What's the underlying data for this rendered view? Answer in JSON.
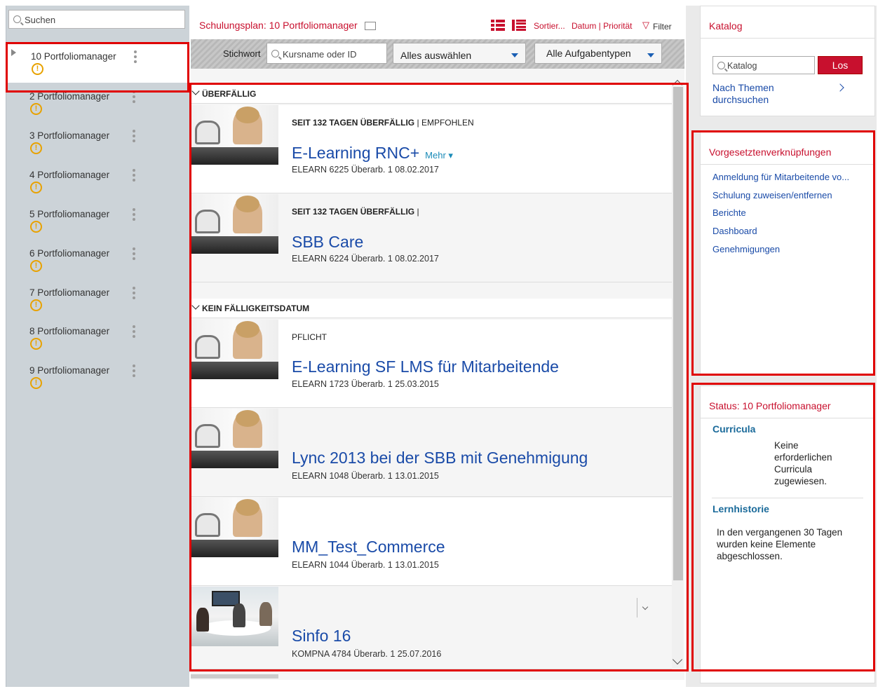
{
  "sidebar": {
    "search_placeholder": "Suchen",
    "selected_manager": "10 Portfoliomanager",
    "managers": [
      "2 Portfoliomanager",
      "3 Portfoliomanager",
      "4 Portfoliomanager",
      "5 Portfoliomanager",
      "6 Portfoliomanager",
      "7 Portfoliomanager",
      "8 Portfoliomanager",
      "9 Portfoliomanager"
    ],
    "warning_glyph": "!"
  },
  "plan": {
    "title": "Schulungsplan: 10 Portfoliomanager",
    "sort_label": "Sortier...",
    "sort_options": "Datum | Priorität",
    "filter_label": "Filter",
    "keyword_label": "Stichwort",
    "keyword_placeholder": "Kursname oder ID",
    "select_all": "Alles auswählen",
    "task_types": "Alle Aufgabentypen"
  },
  "sections": {
    "overdue": "ÜBERFÄLLIG",
    "no_due": "KEIN FÄLLIGKEITSDATUM"
  },
  "courses": [
    {
      "status": "SEIT 132 TAGEN ÜBERFÄLLIG",
      "sep": "|",
      "tag": "EMPFOHLEN",
      "title": "E-Learning RNC+",
      "more": "Mehr ▾",
      "sub": "ELEARN 6225 Überarb. 1 08.02.2017"
    },
    {
      "status": "SEIT 132 TAGEN ÜBERFÄLLIG",
      "sep": "|",
      "tag": "",
      "title": "SBB Care",
      "sub": "ELEARN 6224 Überarb. 1 08.02.2017"
    },
    {
      "status": "PFLICHT",
      "title": "E-Learning SF LMS für Mitarbeitende",
      "sub": "ELEARN 1723 Überarb. 1 25.03.2015"
    },
    {
      "title": "Lync 2013 bei der SBB mit Genehmigung",
      "sub": "ELEARN 1048 Überarb. 1 13.01.2015"
    },
    {
      "title": "MM_Test_Commerce",
      "sub": "ELEARN 1044 Überarb. 1 13.01.2015"
    },
    {
      "title": "Sinfo 16",
      "sub": "KOMPNA 4784 Überarb. 1 25.07.2016"
    }
  ],
  "catalog": {
    "title": "Katalog",
    "placeholder": "Katalog",
    "go": "Los",
    "browse": "Nach Themen durchsuchen"
  },
  "manager_links": {
    "title": "Vorgesetztenverknüpfungen",
    "items": [
      "Anmeldung für Mitarbeitende vo...",
      "Schulung zuweisen/entfernen",
      "Berichte",
      "Dashboard",
      "Genehmigungen"
    ]
  },
  "status": {
    "title": "Status: 10 Portfoliomanager",
    "curricula_h": "Curricula",
    "curricula_text": "Keine erforderlichen Curricula zugewiesen.",
    "history_h": "Lernhistorie",
    "history_text": "In den vergangenen 30 Tagen wurden keine Elemente abgeschlossen."
  },
  "colors": {
    "accent": "#c8102e",
    "link": "#1a4ba8",
    "warning": "#e8a200",
    "highlight": "#e00000"
  }
}
